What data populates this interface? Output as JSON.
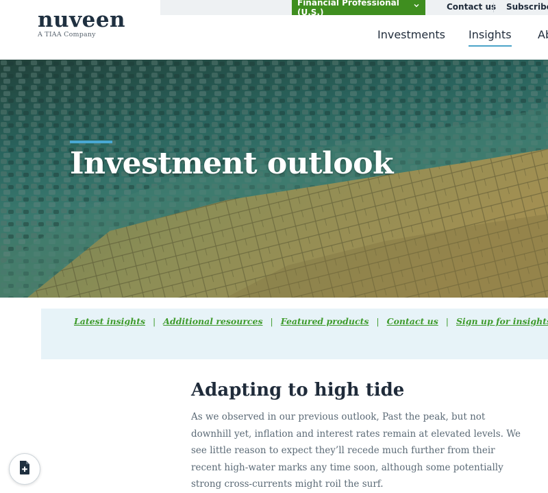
{
  "brand": {
    "logo_text": "nuveen",
    "tagline": "A TIAA Company"
  },
  "utility_nav": {
    "role_selector": "Financial Professional (U.S.)",
    "contact": "Contact us",
    "subscribe": "Subscribe to"
  },
  "main_nav": {
    "items": [
      {
        "label": "Investments"
      },
      {
        "label": "Insights"
      },
      {
        "label": "Ab"
      }
    ],
    "active": "Insights"
  },
  "hero": {
    "title": "Investment outlook"
  },
  "sub_nav": {
    "links": [
      {
        "label": "Latest insights"
      },
      {
        "label": "Additional resources"
      },
      {
        "label": "Featured products"
      },
      {
        "label": "Contact us"
      },
      {
        "label": "Sign up for insights"
      }
    ],
    "separator": "|"
  },
  "article": {
    "title": "Adapting to high tide",
    "body": "As we observed in our previous outlook, Past the peak, but not downhill yet, inflation and interest rates remain at elevated levels. We see little reason to expect they’ll recede much further from their recent high-water marks any time soon, although some potentially strong cross-currents might roil the surf."
  },
  "colors": {
    "brand_green": "#3f8e1f",
    "link_green": "#3f9b2d",
    "accent_blue": "#49a9d4",
    "subnav_bg": "#e7f3f8",
    "navy_text": "#1f2b3a"
  },
  "icons": {
    "role_chevron": "chevron-down-icon",
    "fab": "add-document-icon"
  }
}
